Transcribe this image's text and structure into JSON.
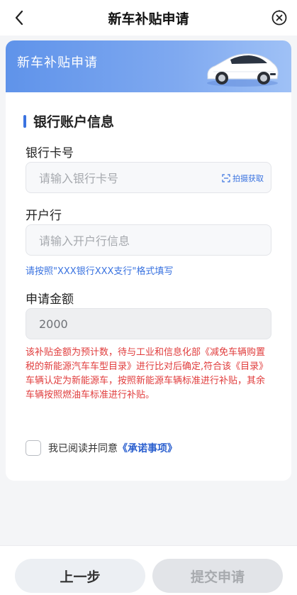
{
  "header": {
    "title": "新车补贴申请"
  },
  "banner": {
    "title": "新车补贴申请"
  },
  "section": {
    "title": "银行账户信息"
  },
  "fields": {
    "bank_card": {
      "label": "银行卡号",
      "placeholder": "请输入银行卡号",
      "scan_label": "拍摄获取"
    },
    "bank_branch": {
      "label": "开户行",
      "placeholder": "请输入开户行信息",
      "hint": "请按照\"XXX银行XXX支行\"格式填写"
    },
    "amount": {
      "label": "申请金额",
      "value": "2000",
      "notice": "该补贴金额为预计数，待与工业和信息化部《减免车辆购置税的新能源汽车车型目录》进行比对后确定,符合该《目录》车辆认定为新能源车，按照新能源车辆标准进行补贴，其余车辆按照燃油车标准进行补贴。"
    }
  },
  "agreement": {
    "text": "我已阅读并同意",
    "link": "《承诺事项》",
    "checked": false
  },
  "footer": {
    "prev_label": "上一步",
    "submit_label": "提交申请"
  },
  "colors": {
    "accent": "#3a73e0",
    "warning": "#e03c3c",
    "banner_start": "#5f93ea",
    "banner_end": "#9fc1f6"
  },
  "icons": {
    "back": "chevron-left-icon",
    "close": "close-circle-icon",
    "scan": "scan-icon",
    "car": "car-image"
  }
}
